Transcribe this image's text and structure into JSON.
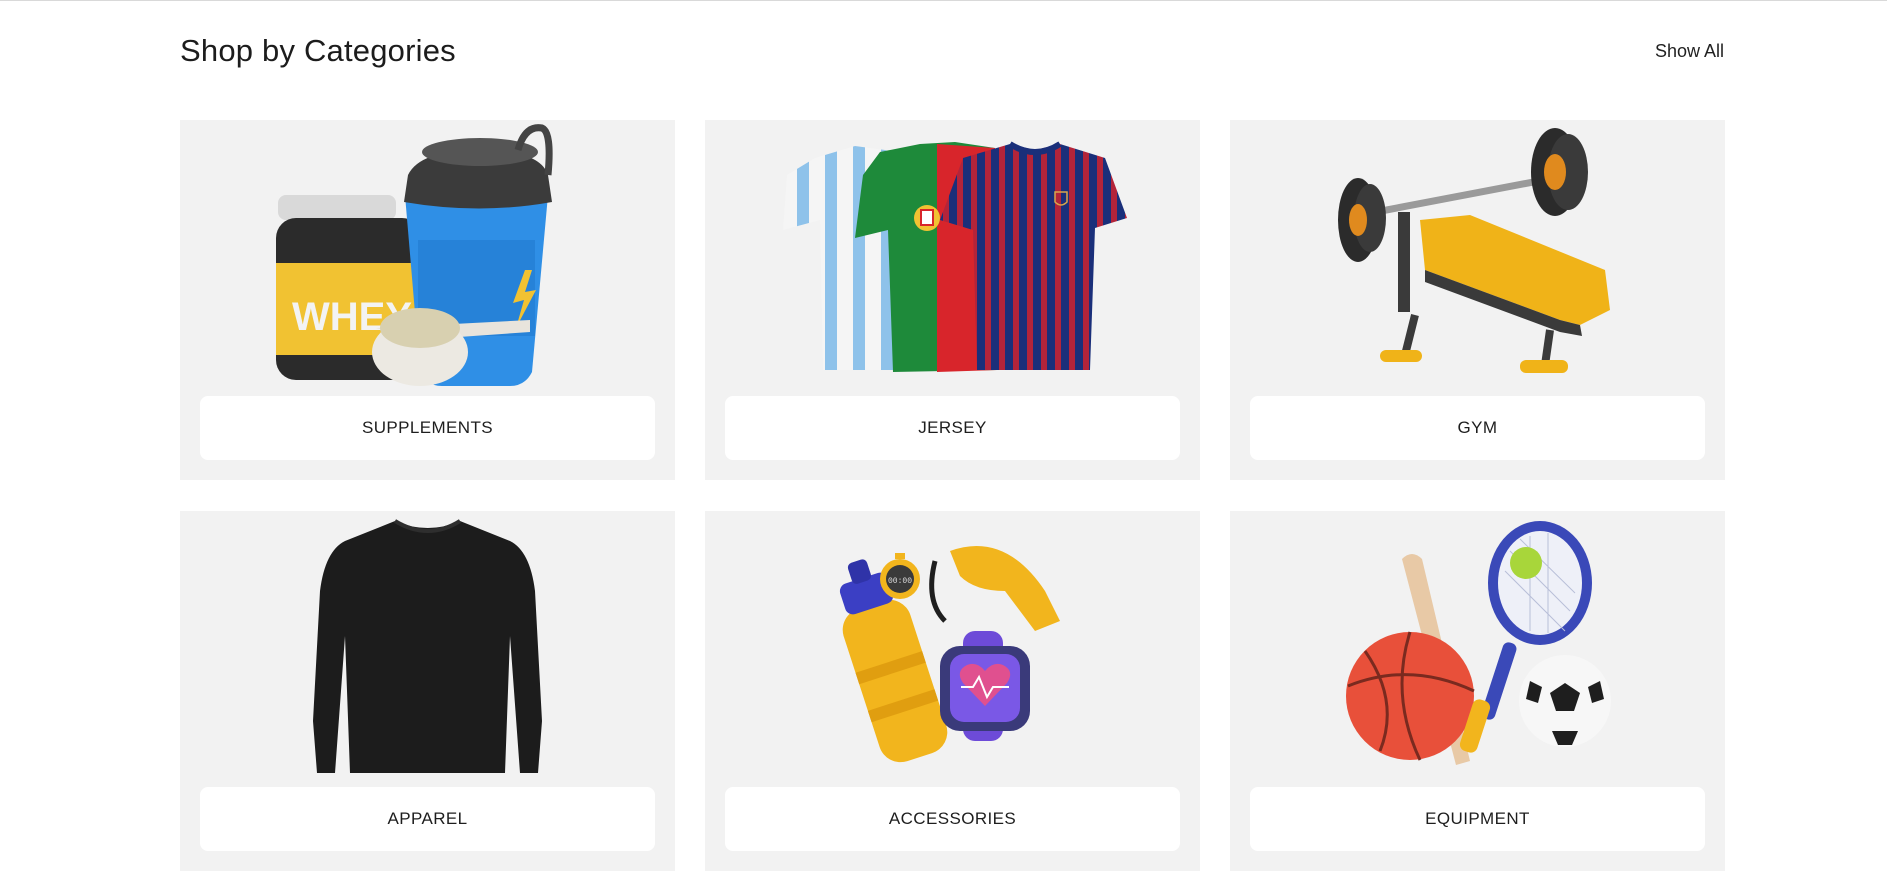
{
  "section": {
    "title": "Shop by Categories",
    "show_all_label": "Show All"
  },
  "categories": [
    {
      "label": "SUPPLEMENTS",
      "icon": "supplements-icon"
    },
    {
      "label": "JERSEY",
      "icon": "jersey-icon"
    },
    {
      "label": "GYM",
      "icon": "gym-bench-icon"
    },
    {
      "label": "APPAREL",
      "icon": "long-sleeve-shirt-icon"
    },
    {
      "label": "ACCESSORIES",
      "icon": "accessories-icon"
    },
    {
      "label": "EQUIPMENT",
      "icon": "sports-equipment-icon"
    }
  ],
  "art_text": {
    "whey": "WHEY",
    "stopwatch": "00:00"
  },
  "colors": {
    "card_bg": "#f2f2f2",
    "label_bg": "#ffffff",
    "text": "#1c1c1c"
  }
}
